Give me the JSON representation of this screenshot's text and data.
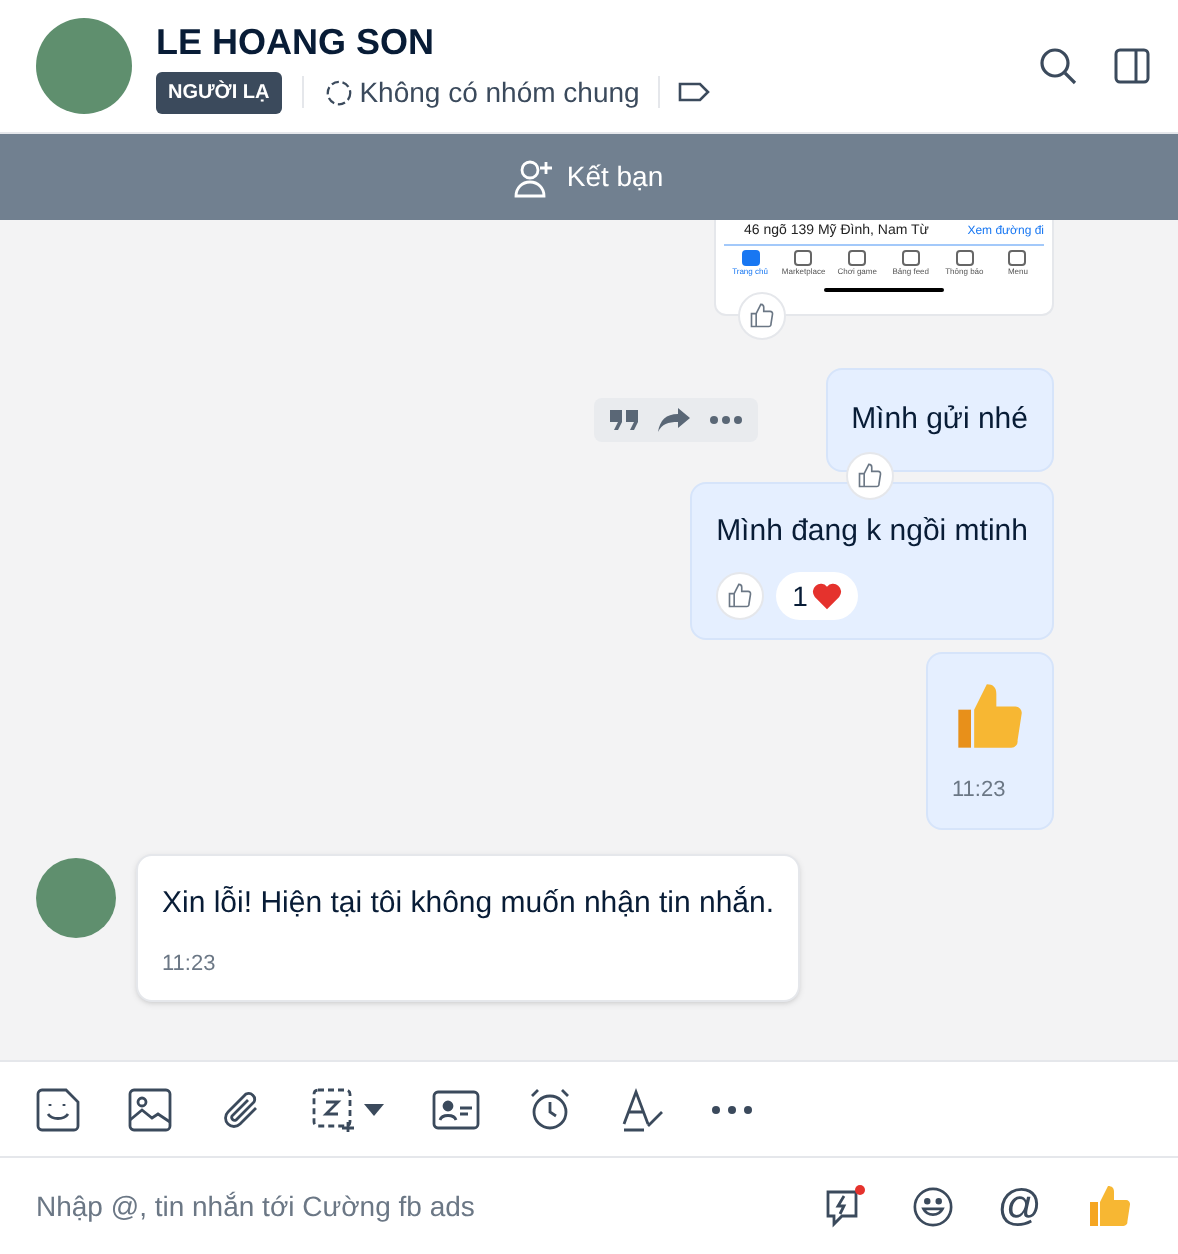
{
  "header": {
    "name": "LE HOANG SON",
    "badge": "NGƯỜI LẠ",
    "groups": "Không có nhóm chung"
  },
  "add_friend": {
    "label": "Kết bạn"
  },
  "messages": [
    {
      "kind": "screenshot",
      "outgoing": true,
      "address": "46 ngõ 139 Mỹ Đình, Nam Từ",
      "link": "Xem đường đi",
      "tabs": [
        {
          "label": "Trang chủ",
          "selected": true
        },
        {
          "label": "Marketplace",
          "selected": false
        },
        {
          "label": "Chơi game",
          "selected": false
        },
        {
          "label": "Bảng feed",
          "selected": false
        },
        {
          "label": "Thông báo",
          "selected": false
        },
        {
          "label": "Menu",
          "selected": false
        }
      ],
      "like_button": true
    },
    {
      "kind": "text",
      "outgoing": true,
      "text": "Mình gửi nhé",
      "like_button": true,
      "actions_shown": true
    },
    {
      "kind": "text",
      "outgoing": true,
      "text": "Mình đang k ngồi mtinh",
      "like_button": true,
      "reaction_count": "1"
    },
    {
      "kind": "sticker",
      "outgoing": true,
      "time": "11:23"
    },
    {
      "kind": "text",
      "outgoing": false,
      "text": "Xin lỗi! Hiện tại tôi không muốn nhận tin nhắn.",
      "time": "11:23"
    }
  ],
  "composer": {
    "placeholder": "Nhập @, tin nhắn tới Cường fb ads",
    "mention_symbol": "@"
  }
}
